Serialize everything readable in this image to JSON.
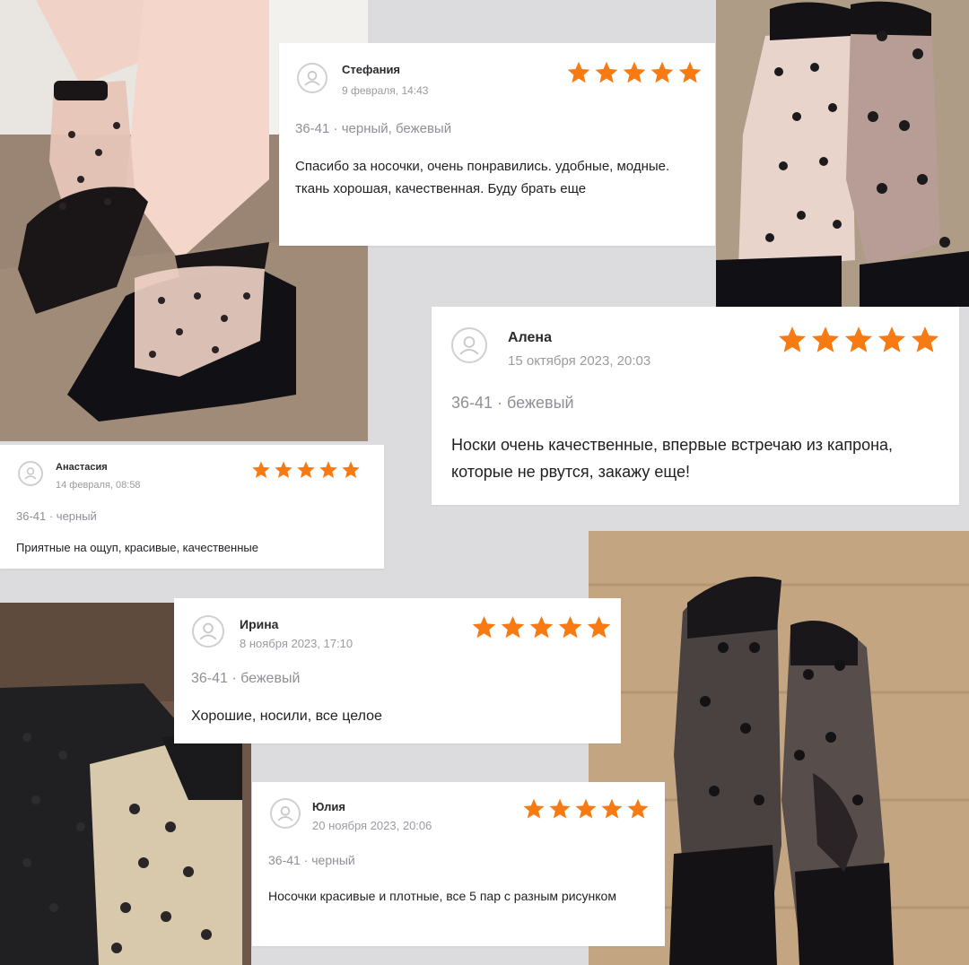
{
  "colors": {
    "star": "#f77a12",
    "background": "#dcdcdf",
    "card": "#ffffff"
  },
  "icons": {
    "avatar": "user-avatar-icon",
    "star": "star-icon"
  },
  "reviews": [
    {
      "name": "Стефания",
      "date": "9 февраля, 14:43",
      "variant": "36-41 · черный, бежевый",
      "text": "Спасибо за носочки, очень понравились. удобные, модные. ткань хорошая, качественная. Буду брать еще",
      "rating": 5
    },
    {
      "name": "Алена",
      "date": "15 октября 2023, 20:03",
      "variant": "36-41 · бежевый",
      "text": "Носки очень качественные, впервые встречаю из капрона, которые не рвутся, закажу еще!",
      "rating": 5
    },
    {
      "name": "Анастасия",
      "date": "14 февраля, 08:58",
      "variant": "36-41 · черный",
      "text": "Приятные на ощуп, красивые, качественные",
      "rating": 5
    },
    {
      "name": "Ирина",
      "date": "8 ноября 2023, 17:10",
      "variant": "36-41 · бежевый",
      "text": "Хорошие, носили, все целое",
      "rating": 5
    },
    {
      "name": "Юлия",
      "date": "20 ноября 2023, 20:06",
      "variant": "36-41 · черный",
      "text": "Носочки красивые и плотные, все 5 пар с разным рисунком",
      "rating": 5
    }
  ]
}
